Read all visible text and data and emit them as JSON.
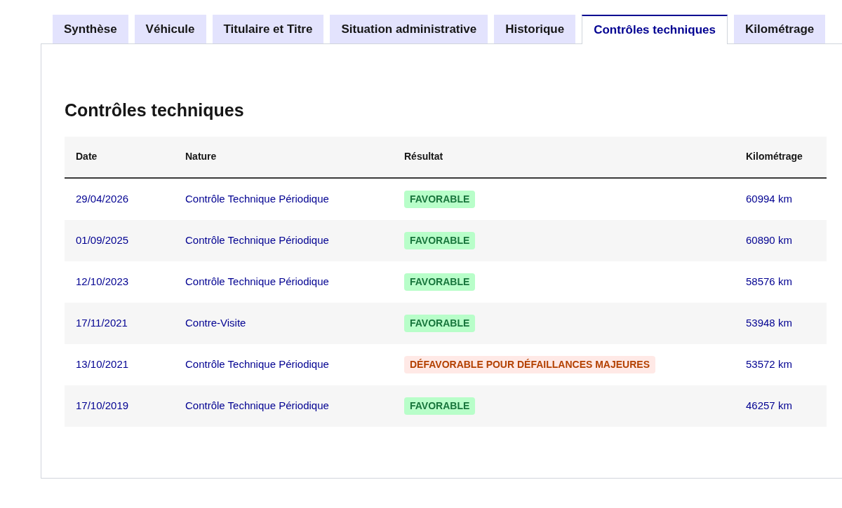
{
  "tabs": [
    {
      "label": "Synthèse",
      "selected": false
    },
    {
      "label": "Véhicule",
      "selected": false
    },
    {
      "label": "Titulaire et Titre",
      "selected": false
    },
    {
      "label": "Situation administrative",
      "selected": false
    },
    {
      "label": "Historique",
      "selected": false
    },
    {
      "label": "Contrôles techniques",
      "selected": true
    },
    {
      "label": "Kilométrage",
      "selected": false
    }
  ],
  "section": {
    "title": "Contrôles techniques"
  },
  "table": {
    "columns": [
      "Date",
      "Nature",
      "Résultat",
      "Kilométrage"
    ],
    "rows": [
      {
        "date": "29/04/2026",
        "nature": "Contrôle Technique Périodique",
        "result": {
          "text": "FAVORABLE",
          "kind": "success"
        },
        "mileage": "60994 km"
      },
      {
        "date": "01/09/2025",
        "nature": "Contrôle Technique Périodique",
        "result": {
          "text": "FAVORABLE",
          "kind": "success"
        },
        "mileage": "60890 km"
      },
      {
        "date": "12/10/2023",
        "nature": "Contrôle Technique Périodique",
        "result": {
          "text": "FAVORABLE",
          "kind": "success"
        },
        "mileage": "58576 km"
      },
      {
        "date": "17/11/2021",
        "nature": "Contre-Visite",
        "result": {
          "text": "FAVORABLE",
          "kind": "success"
        },
        "mileage": "53948 km"
      },
      {
        "date": "13/10/2021",
        "nature": "Contrôle Technique Périodique",
        "result": {
          "text": "DÉFAVORABLE POUR DÉFAILLANCES MAJEURES",
          "kind": "error"
        },
        "mileage": "53572 km"
      },
      {
        "date": "17/10/2019",
        "nature": "Contrôle Technique Périodique",
        "result": {
          "text": "FAVORABLE",
          "kind": "success"
        },
        "mileage": "46257 km"
      }
    ]
  }
}
